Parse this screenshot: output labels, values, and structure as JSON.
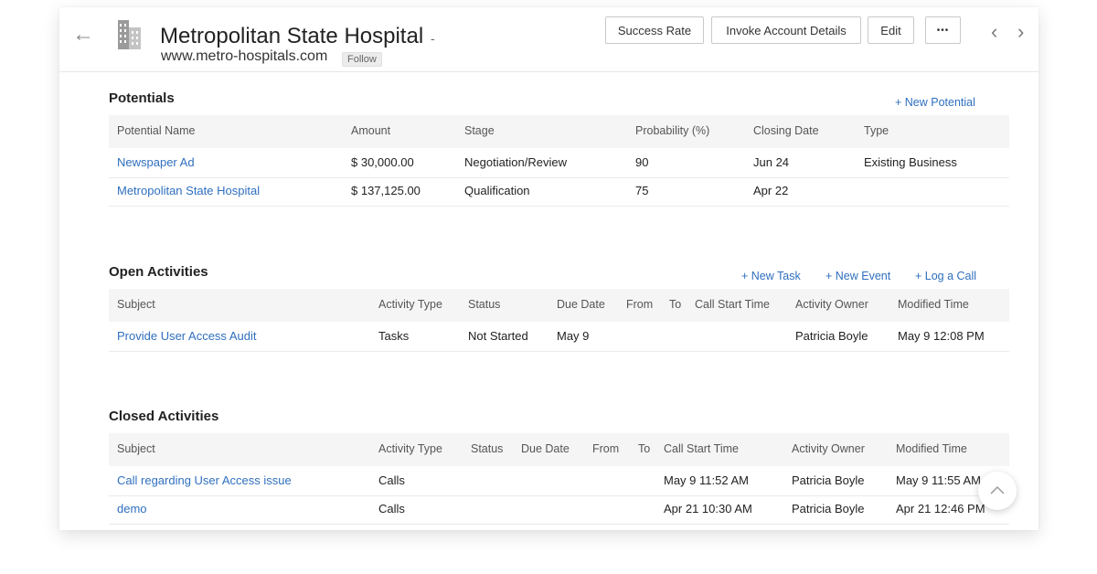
{
  "header": {
    "title": "Metropolitan State Hospital",
    "caret": "-",
    "website": "www.metro-hospitals.com",
    "follow_label": "Follow",
    "buttons": {
      "success_rate": "Success Rate",
      "invoke_account_details": "Invoke Account Details",
      "edit": "Edit",
      "more": "•••"
    }
  },
  "potentials": {
    "title": "Potentials",
    "new_link": "+ New Potential",
    "columns": [
      "Potential Name",
      "Amount",
      "Stage",
      "Probability (%)",
      "Closing Date",
      "Type"
    ],
    "rows": [
      [
        "Newspaper Ad",
        "$ 30,000.00",
        "Negotiation/Review",
        "90",
        "Jun 24",
        "Existing Business"
      ],
      [
        "Metropolitan State Hospital",
        "$ 137,125.00",
        "Qualification",
        "75",
        "Apr 22",
        ""
      ]
    ]
  },
  "open_activities": {
    "title": "Open Activities",
    "links": [
      "+ New Task",
      "+ New Event",
      "+ Log a Call"
    ],
    "columns": [
      "Subject",
      "Activity Type",
      "Status",
      "Due Date",
      "From",
      "To",
      "Call Start Time",
      "Activity Owner",
      "Modified Time"
    ],
    "rows": [
      [
        "Provide User Access Audit",
        "Tasks",
        "Not Started",
        "May 9",
        "",
        "",
        "",
        "Patricia Boyle",
        "May 9 12:08 PM"
      ]
    ]
  },
  "closed_activities": {
    "title": "Closed Activities",
    "columns": [
      "Subject",
      "Activity Type",
      "Status",
      "Due Date",
      "From",
      "To",
      "Call Start Time",
      "Activity Owner",
      "Modified Time"
    ],
    "rows": [
      [
        "Call regarding User Access issue",
        "Calls",
        "",
        "",
        "",
        "",
        "May 9 11:52 AM",
        "Patricia Boyle",
        "May 9 11:55 AM"
      ],
      [
        "demo",
        "Calls",
        "",
        "",
        "",
        "",
        "Apr 21 10:30 AM",
        "Patricia Boyle",
        "Apr 21 12:46 PM"
      ]
    ]
  },
  "icons": {
    "back": "arrow-left-icon",
    "account": "building-icon",
    "prev": "chevron-left-icon",
    "next": "chevron-right-icon",
    "scroll_top": "chevron-up-icon"
  },
  "colors": {
    "link": "#2f6fbf",
    "header_row": "#f5f5f5"
  }
}
